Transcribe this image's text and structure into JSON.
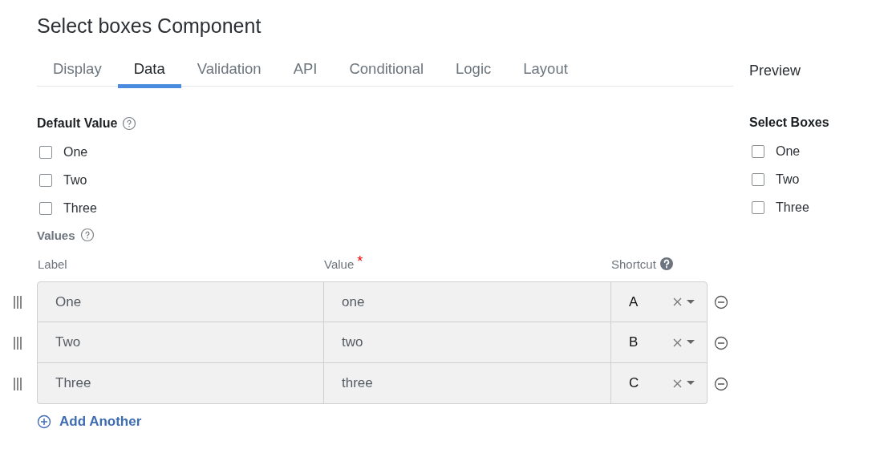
{
  "title": "Select boxes Component",
  "tabs": [
    {
      "label": "Display",
      "selected": false
    },
    {
      "label": "Data",
      "selected": true
    },
    {
      "label": "Validation",
      "selected": false
    },
    {
      "label": "API",
      "selected": false
    },
    {
      "label": "Conditional",
      "selected": false
    },
    {
      "label": "Logic",
      "selected": false
    },
    {
      "label": "Layout",
      "selected": false
    }
  ],
  "default_value": {
    "label": "Default Value",
    "options": [
      {
        "label": "One",
        "checked": false
      },
      {
        "label": "Two",
        "checked": false
      },
      {
        "label": "Three",
        "checked": false
      }
    ]
  },
  "values": {
    "label": "Values",
    "columns": [
      {
        "label": "Label",
        "help": false
      },
      {
        "label": "Value",
        "required_mark": "*",
        "help": false
      },
      {
        "label": "Shortcut",
        "help": true
      }
    ],
    "rows": [
      {
        "label": "One",
        "value": "one",
        "shortcut": "A"
      },
      {
        "label": "Two",
        "value": "two",
        "shortcut": "B"
      },
      {
        "label": "Three",
        "value": "three",
        "shortcut": "C"
      }
    ],
    "add_button": "Add Another"
  },
  "preview": {
    "title": "Preview",
    "label": "Select Boxes",
    "options": [
      {
        "label": "One",
        "checked": false
      },
      {
        "label": "Two",
        "checked": false
      },
      {
        "label": "Three",
        "checked": false
      }
    ]
  }
}
